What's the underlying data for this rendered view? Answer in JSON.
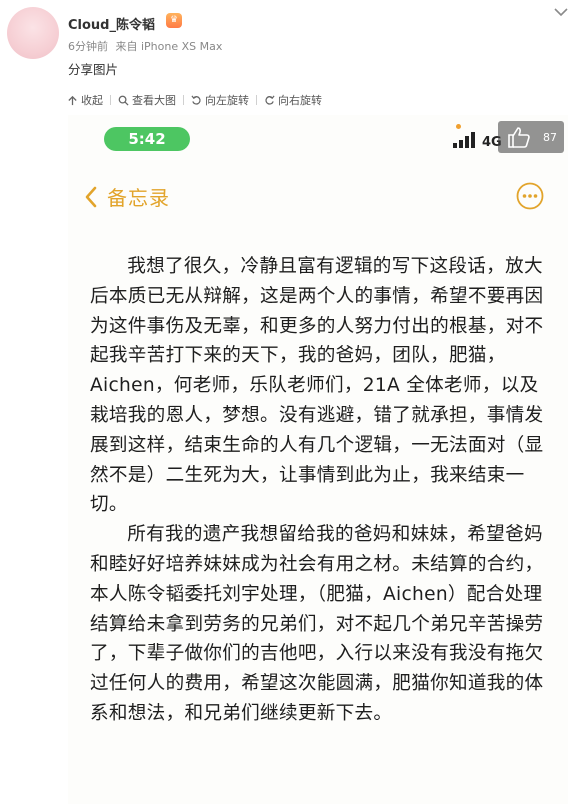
{
  "post": {
    "username": "Cloud_陈令韬",
    "time": "6分钟前",
    "source": "来自 iPhone XS Max",
    "text": "分享图片"
  },
  "toolbar": {
    "collapse": "收起",
    "view_large": "查看大图",
    "rotate_left": "向左旋转",
    "rotate_right": "向右旋转"
  },
  "image": {
    "status_time": "5:42",
    "network": "4G",
    "like_count": "87",
    "nav_title": "备忘录",
    "paragraphs": [
      "我想了很久，冷静且富有逻辑的写下这段话，放大后本质已无从辩解，这是两个人的事情，希望不要再因为这件事伤及无辜，和更多的人努力付出的根基，对不起我辛苦打下来的天下，我的爸妈，团队，肥猫，Aichen，何老师，乐队老师们，21A 全体老师，以及栽培我的恩人，梦想。没有逃避，错了就承担，事情发展到这样，结束生命的人有几个逻辑，一无法面对（显然不是）二生死为大，让事情到此为止，我来结束一切。",
      "所有我的遗产我想留给我的爸妈和妹妹，希望爸妈和睦好好培养妹妹成为社会有用之材。未结算的合约，本人陈令韬委托刘宇处理，（肥猫，Aichen）配合处理结算给未拿到劳务的兄弟们，对不起几个弟兄辛苦操劳了，下辈子做你们的吉他吧，入行以来没有我没有拖欠过任何人的费用，希望这次能圆满，肥猫你知道我的体系和想法，和兄弟们继续更新下去。"
    ]
  },
  "colors": {
    "status_green": "#4dc662",
    "notes_accent": "#e2a42b"
  }
}
